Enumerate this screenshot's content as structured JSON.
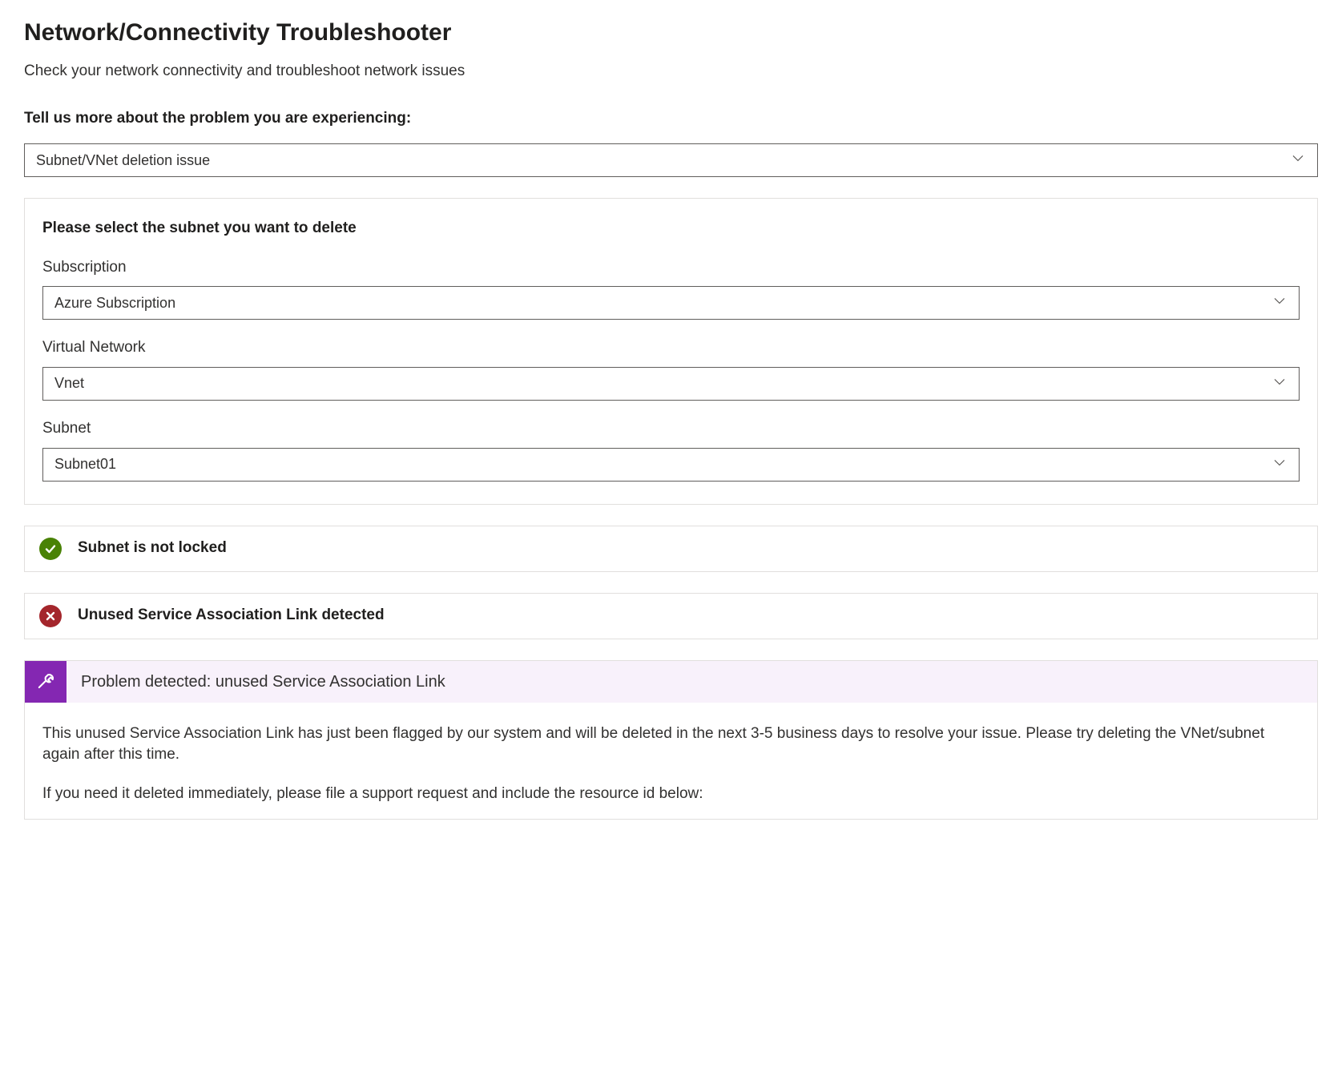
{
  "header": {
    "title": "Network/Connectivity Troubleshooter",
    "subtitle": "Check your network connectivity and troubleshoot network issues"
  },
  "problemPrompt": {
    "label": "Tell us more about the problem you are experiencing:",
    "selected": "Subnet/VNet deletion issue"
  },
  "selection": {
    "title": "Please select the subnet you want to delete",
    "subscription": {
      "label": "Subscription",
      "value": "Azure Subscription"
    },
    "vnet": {
      "label": "Virtual Network",
      "value": "Vnet"
    },
    "subnet": {
      "label": "Subnet",
      "value": "Subnet01"
    }
  },
  "checks": {
    "lock": {
      "text": "Subnet is not locked"
    },
    "sal": {
      "text": "Unused Service Association Link detected"
    }
  },
  "problem": {
    "headerText": "Problem detected: unused Service Association Link",
    "body1": "This unused Service Association Link has just been flagged by our system and will be deleted in the next 3-5 business days to resolve your issue. Please try deleting the VNet/subnet again after this time.",
    "body2": "If you need it deleted immediately, please file a support request and include the resource id below:"
  }
}
